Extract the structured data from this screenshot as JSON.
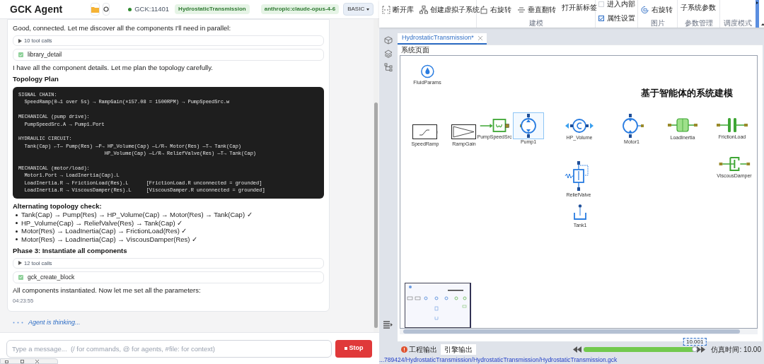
{
  "header": {
    "app_name": "GCK Agent",
    "connection": {
      "label": "GCK:11401",
      "connected": true
    },
    "project_badge": "HydrostaticTransmission",
    "model_badge": "anthropic:claude-opus-4-6",
    "mode": "BASIC"
  },
  "messages": [
    {
      "kind": "text",
      "text": "Good, connected. Let me discover all the components I'll need in parallel:"
    },
    {
      "kind": "toolcalls",
      "text": "10 tool calls"
    },
    {
      "kind": "tool",
      "text": "library_detail",
      "done": true
    },
    {
      "kind": "text",
      "text": "I have all the component details. Let me plan the topology carefully."
    },
    {
      "kind": "heading",
      "text": "Topology Plan"
    },
    {
      "kind": "code",
      "text": "SIGNAL CHAIN:\n  SpeedRamp(0→1 over 5s) → RampGain(×157.08 = 1500RPM) → PumpSpeedSrc.w\n\nMECHANICAL (pump drive):\n  PumpSpeedSrc.A → Pump1.Port\n\nHYDRAULIC CIRCUIT:\n  Tank(Cap) ←T— Pump(Res) —P→ HP_Volume(Cap) —L/R→ Motor(Res) —T→ Tank(Cap)\n                             HP_Volume(Cap) —L/R→ ReliefValve(Res) —T→ Tank(Cap)\n\nMECHANICAL (motor/load):\n  Motor1.Port → LoadInertia(Cap).L\n  LoadInertia.R → FrictionLoad(Res).L      [FrictionLoad.R unconnected = grounded]\n  LoadInertia.R → ViscousDamper(Res).L     [ViscousDamper.R unconnected = grounded]"
    },
    {
      "kind": "heading",
      "text": "Alternating topology check:"
    },
    {
      "kind": "list",
      "items": [
        "Tank(Cap) → Pump(Res) → HP_Volume(Cap) → Motor(Res) → Tank(Cap) ✓",
        "HP_Volume(Cap) → ReliefValve(Res) → Tank(Cap) ✓",
        "Motor(Res) → LoadInertia(Cap) → FrictionLoad(Res) ✓",
        "Motor(Res) → LoadInertia(Cap) → ViscousDamper(Res) ✓"
      ]
    },
    {
      "kind": "heading",
      "text": "Phase 3: Instantiate all components"
    },
    {
      "kind": "toolcalls",
      "text": "12 tool calls"
    },
    {
      "kind": "tool",
      "text": "gck_create_block",
      "done": true
    },
    {
      "kind": "text",
      "text": "All components instantiated. Now let me set all the parameters:"
    },
    {
      "kind": "timestamp",
      "text": "04:23:55"
    }
  ],
  "status": "Agent is thinking...",
  "composer": {
    "placeholder": "Type a message...  (/ for commands, @ for agents, #file: for context)",
    "stop_button": "Stop"
  },
  "ribbon": {
    "groups": [
      {
        "items": [
          {
            "kind": "button",
            "label": "断开库"
          },
          {
            "kind": "button",
            "label": "创建虚拟子系统"
          }
        ]
      },
      {
        "label": "建模",
        "items": [
          {
            "kind": "button",
            "label": "右旋转"
          },
          {
            "kind": "button",
            "label": "垂直翻转"
          },
          {
            "kind": "text",
            "label": "打开新标签"
          }
        ]
      },
      {
        "items": [
          {
            "kind": "checkbox",
            "label": "进入内部",
            "checked": false
          },
          {
            "kind": "checkbox",
            "label": "属性设置",
            "checked": true
          }
        ]
      },
      {
        "label": "图片",
        "items": [
          {
            "kind": "button",
            "label": "右旋转"
          }
        ]
      },
      {
        "label": "参数管理",
        "items": [
          {
            "kind": "text",
            "label": "子系统参数"
          }
        ]
      },
      {
        "label": "调度模式"
      }
    ]
  },
  "document_tab": {
    "title": "HydrostaticTransmission*",
    "selected": true
  },
  "page_label": "系统页面",
  "diagram": {
    "title": "基于智能体的系统建模",
    "blocks": [
      {
        "kind": "drop",
        "name": "FluidParams",
        "selected": false
      },
      {
        "kind": "ramp",
        "name": "SpeedRamp",
        "selected": false
      },
      {
        "kind": "gain",
        "name": "RampGain",
        "selected": false
      },
      {
        "kind": "source",
        "name": "PumpSpeedSrc",
        "selected": false
      },
      {
        "kind": "pump",
        "name": "Pump1",
        "selected": true
      },
      {
        "kind": "volume",
        "name": "HP_Volume",
        "selected": false
      },
      {
        "kind": "motor",
        "name": "Motor1",
        "selected": false
      },
      {
        "kind": "inertia",
        "name": "LoadInertia",
        "selected": false
      },
      {
        "kind": "friction",
        "name": "FrictionLoad",
        "selected": false
      },
      {
        "kind": "damper",
        "name": "ViscousDamper",
        "selected": false
      },
      {
        "kind": "valve",
        "name": "ReliefValve",
        "selected": false
      },
      {
        "kind": "tank",
        "name": "Tank1",
        "selected": false
      }
    ]
  },
  "output_tabs": [
    {
      "label": "工程输出",
      "selected": false,
      "alert": true
    },
    {
      "label": "引擎输出",
      "selected": true,
      "alert": false
    }
  ],
  "simulation": {
    "level": 0.98,
    "value": "10.001",
    "time_label": "仿真时间: 10.00"
  },
  "file_path": "...789424/HydrostaticTransmission/HydrostaticTransmission/HydrostaticTransmission.gck"
}
